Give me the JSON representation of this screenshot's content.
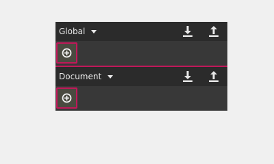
{
  "sections": [
    {
      "name": "Global",
      "dropdown_icon": "chevron-down-icon",
      "actions": [
        {
          "icon": "download-icon"
        },
        {
          "icon": "upload-icon"
        }
      ],
      "add_icon": "plus-circle-icon"
    },
    {
      "name": "Document",
      "dropdown_icon": "chevron-down-icon",
      "actions": [
        {
          "icon": "download-icon"
        },
        {
          "icon": "upload-icon"
        }
      ],
      "add_icon": "plus-circle-icon"
    }
  ],
  "colors": {
    "panel_bg": "#3a3a3a",
    "header_bg": "#2b2b2b",
    "accent": "#c1185a",
    "text": "#eaeaea",
    "page_bg": "#f0f0f0"
  }
}
